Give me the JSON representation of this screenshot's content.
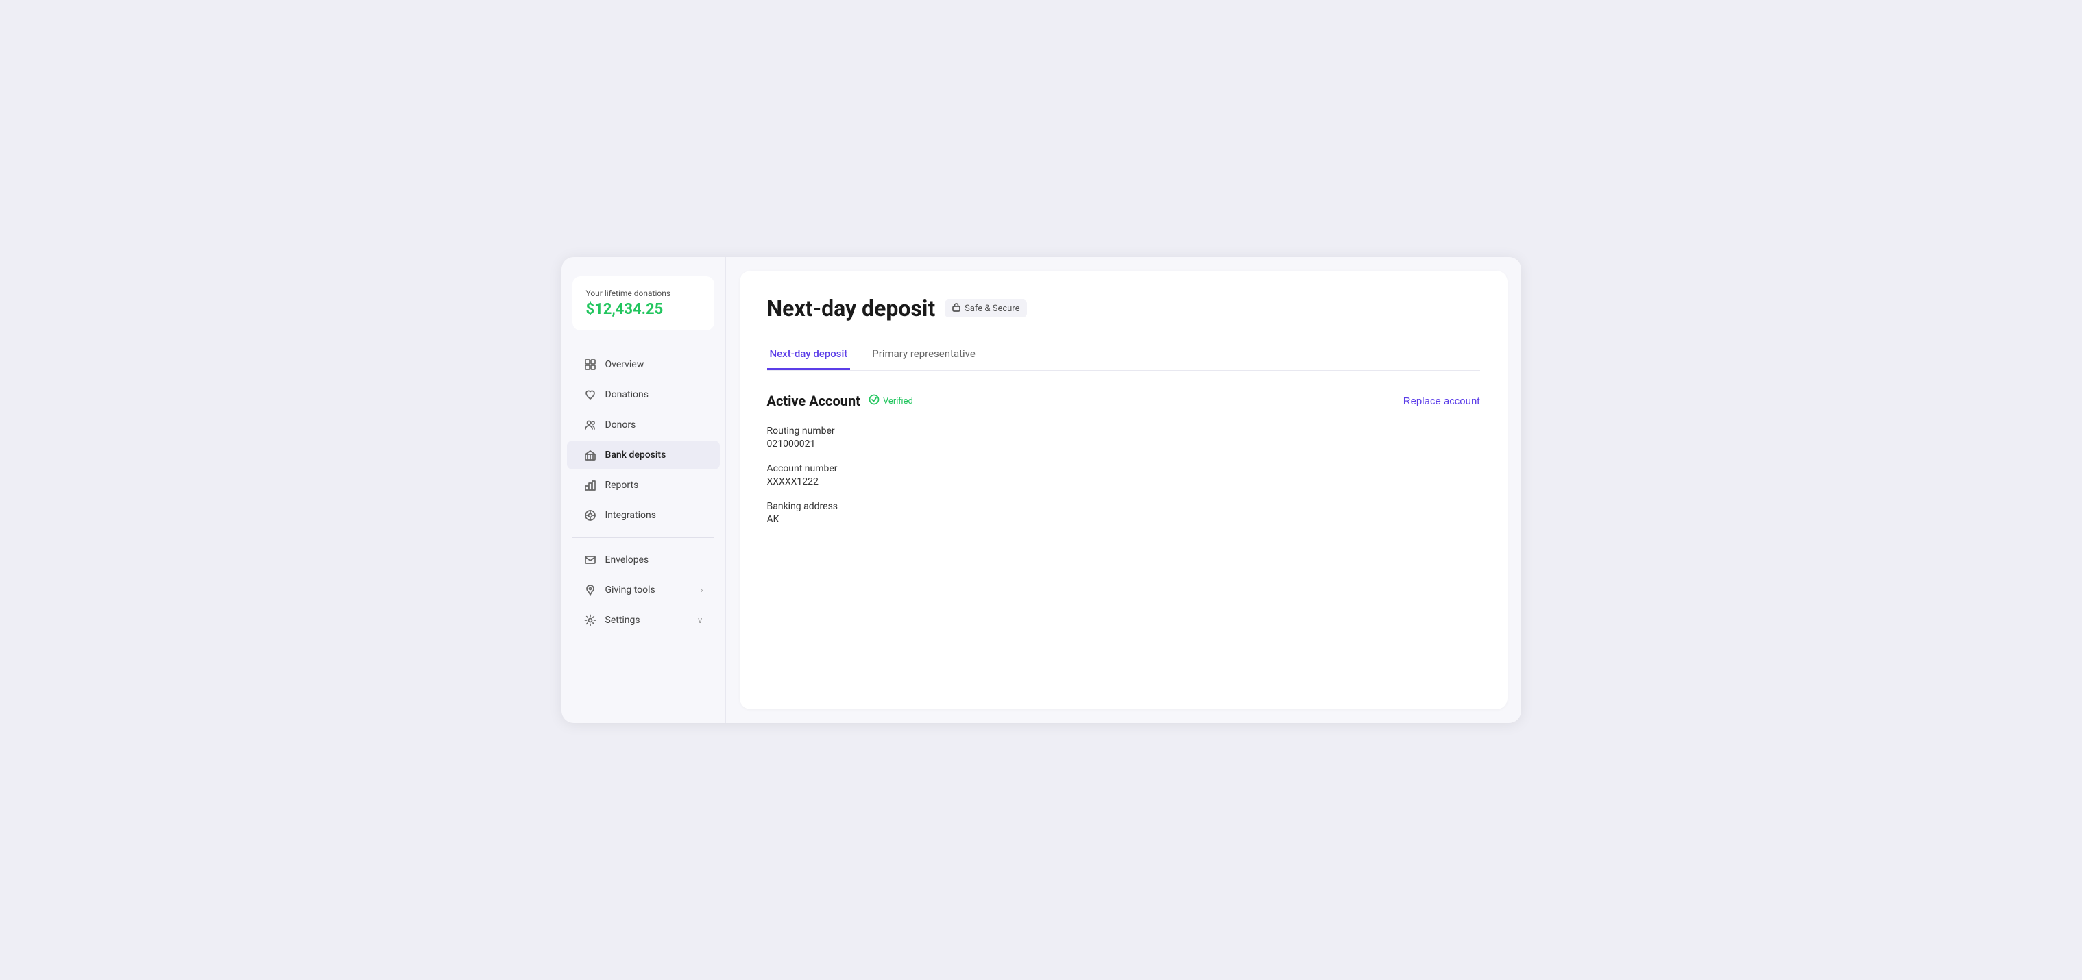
{
  "sidebar": {
    "lifetime_label": "Your lifetime donations",
    "lifetime_amount": "$12,434.25",
    "nav_items": [
      {
        "id": "overview",
        "label": "Overview",
        "icon": "grid-icon",
        "active": false
      },
      {
        "id": "donations",
        "label": "Donations",
        "icon": "heart-icon",
        "active": false
      },
      {
        "id": "donors",
        "label": "Donors",
        "icon": "users-icon",
        "active": false
      },
      {
        "id": "bank-deposits",
        "label": "Bank deposits",
        "icon": "bank-icon",
        "active": true
      },
      {
        "id": "reports",
        "label": "Reports",
        "icon": "bar-chart-icon",
        "active": false
      },
      {
        "id": "integrations",
        "label": "Integrations",
        "icon": "integrations-icon",
        "active": false
      }
    ],
    "nav_items_bottom": [
      {
        "id": "envelopes",
        "label": "Envelopes",
        "icon": "envelope-icon",
        "chevron": false
      },
      {
        "id": "giving-tools",
        "label": "Giving tools",
        "icon": "giving-icon",
        "chevron": "›"
      },
      {
        "id": "settings",
        "label": "Settings",
        "icon": "settings-icon",
        "chevron": "∨"
      }
    ]
  },
  "header": {
    "title": "Next-day deposit",
    "secure_label": "Safe & Secure"
  },
  "tabs": [
    {
      "id": "next-day",
      "label": "Next-day deposit",
      "active": true
    },
    {
      "id": "primary-rep",
      "label": "Primary representative",
      "active": false
    }
  ],
  "account": {
    "section_title": "Active Account",
    "verified_label": "Verified",
    "replace_button": "Replace account",
    "routing_label": "Routing number",
    "routing_value": "021000021",
    "account_number_label": "Account number",
    "account_number_value": "XXXXX1222",
    "banking_address_label": "Banking address",
    "banking_address_value": "AK"
  }
}
